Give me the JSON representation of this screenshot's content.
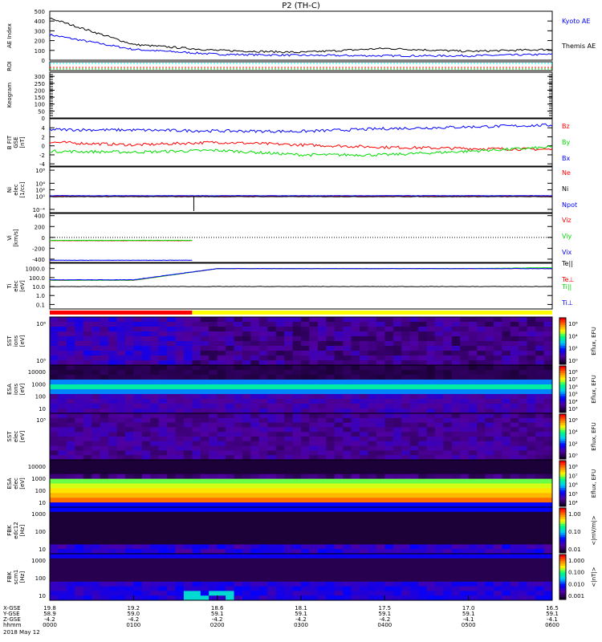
{
  "title": "P2 (TH-C)",
  "chart_data": {
    "type": "line",
    "title": "P2 (TH-C)",
    "x_hours": [
      0,
      1,
      2,
      3,
      4,
      5,
      6
    ],
    "x_range_hours": [
      0,
      6
    ],
    "panels": [
      {
        "id": "ae",
        "label": [
          "AE Index"
        ],
        "scale": "linear",
        "ylim": [
          0,
          500
        ],
        "ticks": [
          "500",
          "400",
          "300",
          "200",
          "100",
          "0"
        ],
        "tickvals": [
          500,
          400,
          300,
          200,
          100,
          0
        ],
        "series": [
          {
            "name": "Kyoto AE",
            "color": "#0000ff",
            "values": [
              260,
              110,
              60,
              50,
              45,
              45,
              60
            ]
          },
          {
            "name": "Themis AE",
            "color": "#000000",
            "values": [
              430,
              160,
              100,
              80,
              120,
              90,
              110
            ]
          }
        ]
      },
      {
        "id": "roi",
        "label": [
          "ROI"
        ],
        "scale": "none",
        "ticks": [],
        "tickvals": [],
        "series": []
      },
      {
        "id": "keogram",
        "label": [
          "Keogram"
        ],
        "scale": "linear",
        "ylim": [
          0,
          330
        ],
        "ticks": [
          "300",
          "250",
          "200",
          "150",
          "100",
          "50",
          "0"
        ],
        "tickvals": [
          300,
          250,
          200,
          150,
          100,
          50,
          0
        ],
        "series": []
      },
      {
        "id": "bfit",
        "label": [
          "B FIT",
          "GSE",
          "[nT]"
        ],
        "scale": "linear",
        "ylim": [
          -4.5,
          6
        ],
        "ticks": [
          "4",
          "2",
          "0",
          "-2",
          "-4"
        ],
        "tickvals": [
          4,
          2,
          0,
          -2,
          -4
        ],
        "series": [
          {
            "name": "Bz",
            "color": "#ff0000",
            "values": [
              0.8,
              0.2,
              0.8,
              0.2,
              -0.3,
              -0.6,
              -0.8
            ]
          },
          {
            "name": "By",
            "color": "#00dd00",
            "values": [
              -1.2,
              -1.4,
              -1.0,
              -2.0,
              -2.0,
              -1.2,
              -0.3
            ]
          },
          {
            "name": "Bx",
            "color": "#0000ff",
            "values": [
              3.6,
              3.5,
              3.3,
              3.2,
              3.8,
              4.2,
              4.6
            ]
          }
        ]
      },
      {
        "id": "ni",
        "label": [
          "Ni",
          "elec",
          "[1/cc]"
        ],
        "scale": "log",
        "ylim": [
          -5,
          9
        ],
        "ticks": [
          "10⁸",
          "10⁴",
          "10²",
          "10⁰",
          "10⁻⁴"
        ],
        "tickvals": [
          8,
          4,
          2,
          0,
          -4
        ],
        "series": [
          {
            "name": "Ne",
            "color": "#ff0000",
            "values": [
              0.05,
              0.05,
              0.05,
              0.05,
              0.05,
              0.05,
              0.05
            ]
          },
          {
            "name": "Ni",
            "color": "#000000",
            "values": [
              -0.1,
              -0.1,
              -0.1,
              -0.1,
              -0.1,
              -0.1,
              -0.1
            ]
          },
          {
            "name": "Npot",
            "color": "#0000ff",
            "values": [
              0.2,
              0.2,
              0.2,
              0.2,
              0.2,
              0.2,
              0.2
            ]
          }
        ]
      },
      {
        "id": "vi",
        "label": [
          "Vi",
          "[km/s]"
        ],
        "scale": "linear",
        "ylim": [
          -460,
          440
        ],
        "ticks": [
          "400",
          "200",
          "0",
          "-200",
          "-400"
        ],
        "tickvals": [
          400,
          200,
          0,
          -200,
          -400
        ],
        "series": [
          {
            "name": "Viz",
            "color": "#ff0000",
            "values": [
              -60,
              -60
            ]
          },
          {
            "name": "Viy",
            "color": "#00dd00",
            "values": [
              -55,
              -55
            ]
          },
          {
            "name": "Vix",
            "color": "#0000ff",
            "values": [
              -420,
              -420
            ]
          }
        ],
        "series_end_hour": 1.7
      },
      {
        "id": "ti",
        "label": [
          "Ti",
          "elec",
          "[eV]"
        ],
        "scale": "log",
        "ylim": [
          -1.5,
          3.6
        ],
        "ticks": [
          "1000.0",
          "100.0",
          "10.0",
          "1.0",
          "0.1"
        ],
        "tickvals": [
          3,
          2,
          1,
          0,
          -1
        ],
        "series": [
          {
            "name": "Te||",
            "color": "#000000",
            "values": [
              1,
              1,
              1,
              1,
              1,
              1,
              1
            ]
          },
          {
            "name": "Te⊥",
            "color": "#ff0000",
            "values": [
              1.7,
              1.7,
              3,
              3,
              3,
              3,
              3
            ]
          },
          {
            "name": "Ti||",
            "color": "#00dd00",
            "values": [
              1.7,
              1.7,
              3.0,
              3.0,
              3.0,
              3.0,
              3.1
            ]
          },
          {
            "name": "Ti⊥",
            "color": "#0000ff",
            "values": [
              1.75,
              1.75,
              3,
              3,
              3,
              3,
              3
            ]
          }
        ]
      }
    ],
    "mode_bar": {
      "segments": [
        {
          "from": 0,
          "to": 1.7,
          "color": "#ff0000"
        },
        {
          "from": 1.7,
          "to": 6,
          "color": "#ffff00"
        }
      ]
    },
    "spectrograms": [
      {
        "id": "sst-ion",
        "label": [
          "SST",
          "ions",
          "[eV]"
        ],
        "ticks": [
          "10⁶",
          "10⁵"
        ],
        "cbar_ticks": [
          "10⁶",
          "10⁴",
          "10²",
          "10⁰"
        ],
        "cbar_label": "Eflux, EFU"
      },
      {
        "id": "esa-ion",
        "label": [
          "ESA",
          "ions",
          "[eV]"
        ],
        "ticks": [
          "10000",
          "1000",
          "100",
          "10"
        ],
        "cbar_ticks": [
          "10⁸",
          "10⁷",
          "10⁶",
          "10⁵",
          "10⁴",
          "10³"
        ],
        "cbar_label": "Eflux, EFU"
      },
      {
        "id": "sst-elec",
        "label": [
          "SST",
          "elec",
          "[eV]"
        ],
        "ticks": [
          "10⁵"
        ],
        "cbar_ticks": [
          "10⁶",
          "10⁴",
          "10²",
          "10⁰"
        ],
        "cbar_label": "Eflux, EFU"
      },
      {
        "id": "esa-elec",
        "label": [
          "ESA",
          "elec",
          "[eV]"
        ],
        "ticks": [
          "10000",
          "1000",
          "100",
          "10"
        ],
        "cbar_ticks": [
          "10⁸",
          "10⁷",
          "10⁶",
          "10⁵",
          "10⁴"
        ],
        "cbar_label": "Eflux, EFU"
      },
      {
        "id": "fbk-edc12",
        "label": [
          "FBK",
          "edc12",
          "[Hz]"
        ],
        "ticks": [
          "1000",
          "100",
          "10"
        ],
        "cbar_ticks": [
          "1.00",
          "0.10",
          "0.01"
        ],
        "cbar_label": "<|mV/m|>"
      },
      {
        "id": "fbk-scm1",
        "label": [
          "FBK",
          "scm1",
          "[Hz]"
        ],
        "ticks": [
          "1000",
          "100",
          "10"
        ],
        "cbar_ticks": [
          "1.000",
          "0.100",
          "0.010",
          "0.001"
        ],
        "cbar_label": "<|nT|>"
      }
    ],
    "x_axis": {
      "rows": [
        {
          "label": "X-GSE",
          "values": [
            "19.8",
            "19.2",
            "18.6",
            "18.1",
            "17.5",
            "17.0",
            "16.5"
          ]
        },
        {
          "label": "Y-GSE",
          "values": [
            "58.9",
            "59.0",
            "59.1",
            "59.1",
            "59.1",
            "59.1",
            "59.1"
          ]
        },
        {
          "label": "Z-GSE",
          "values": [
            "-4.2",
            "-4.2",
            "-4.2",
            "-4.2",
            "-4.2",
            "-4.1",
            "-4.1"
          ]
        },
        {
          "label": "hhmm",
          "values": [
            "0000",
            "0100",
            "0200",
            "0300",
            "0400",
            "0500",
            "0600"
          ]
        }
      ],
      "date": "2018 May 12"
    }
  }
}
